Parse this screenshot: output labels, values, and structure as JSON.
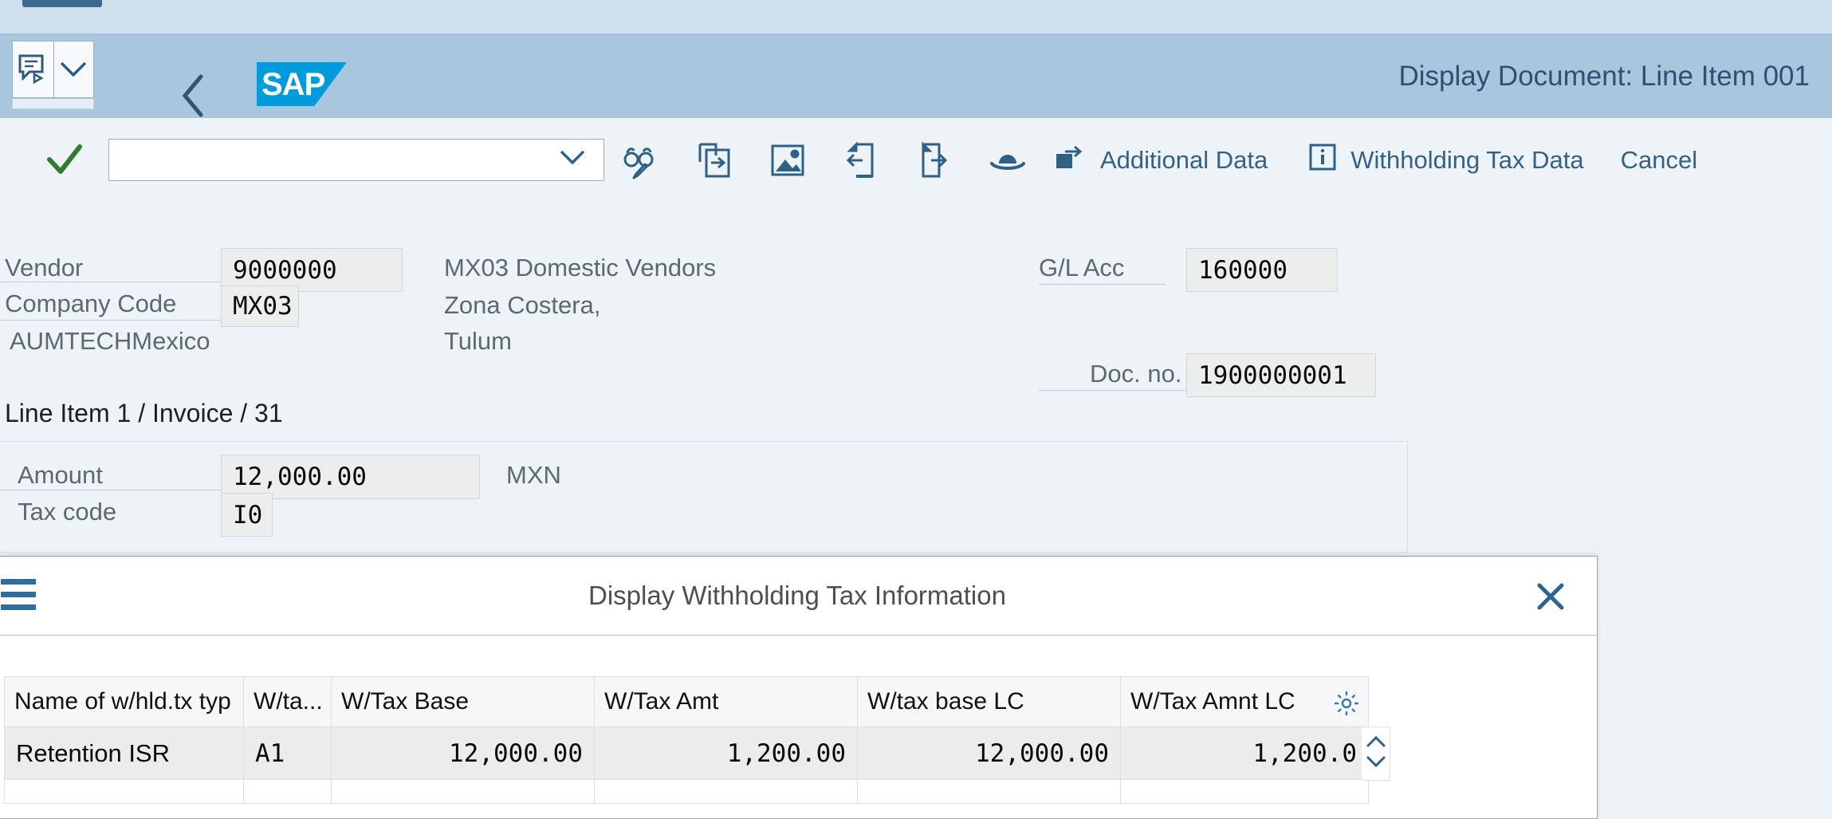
{
  "header": {
    "title": "Display Document: Line Item 001",
    "logo_text": "SAP",
    "back_icon": "back-chevron-icon",
    "notes_icon": "notes-icon",
    "chevron_icon": "chevron-down-icon"
  },
  "toolbar": {
    "confirm_icon": "green-check-icon",
    "combo_value": "",
    "combo_chevron": "chevron-down-icon",
    "icons": [
      {
        "name": "display-change-icon"
      },
      {
        "name": "document-enter-icon"
      },
      {
        "name": "picture-icon"
      },
      {
        "name": "previous-item-icon"
      },
      {
        "name": "next-item-icon"
      },
      {
        "name": "hat-icon"
      }
    ],
    "additional_data_label": "Additional Data",
    "additional_data_icon": "square-arrow-icon",
    "withholding_tax_label": "Withholding Tax Data",
    "withholding_tax_icon": "info-icon",
    "cancel_label": "Cancel"
  },
  "form": {
    "vendor_label": "Vendor",
    "vendor_value": "9000000",
    "company_code_label": "Company Code",
    "company_code_value": "MX03",
    "company_name": "AUMTECHMexico",
    "vendor_desc": "MX03 Domestic Vendors",
    "address_line1": "Zona Costera,",
    "address_line2": "Tulum",
    "gl_acc_label": "G/L Acc",
    "gl_acc_value": "160000",
    "doc_no_label": "Doc. no.",
    "doc_no_value": "1900000001",
    "line_item_title": "Line Item 1 / Invoice / 31",
    "amount_label": "Amount",
    "amount_value": "12,000.00",
    "currency": "MXN",
    "tax_code_label": "Tax code",
    "tax_code_value": "I0"
  },
  "dialog": {
    "title": "Display Withholding Tax Information",
    "menu_icon": "hamburger-icon",
    "close_icon": "close-icon",
    "settings_icon": "gear-icon",
    "scroll_up_icon": "chevron-up-icon",
    "scroll_down_icon": "chevron-down-icon",
    "table": {
      "columns": [
        "Name of w/hld.tx typ",
        "W/ta...",
        "W/Tax Base",
        "W/Tax Amt",
        "W/tax base LC",
        "W/Tax Amnt LC"
      ],
      "rows": [
        {
          "name": "Retention ISR",
          "code": "A1",
          "wtax_base": "12,000.00",
          "wtax_amt": "1,200.00",
          "wtax_base_lc": "12,000.00",
          "wtax_amt_lc": "1,200.0"
        }
      ]
    }
  },
  "colors": {
    "sap_blue": "#009bdc",
    "header_band": "#a8c6de",
    "accent_text": "#346187",
    "check_green": "#2e7d32"
  }
}
